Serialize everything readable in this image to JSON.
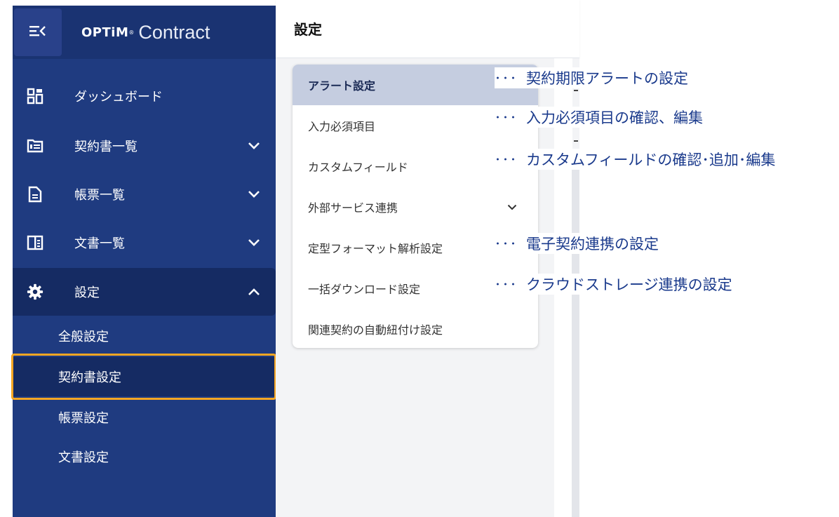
{
  "app": {
    "brand_optim": "OPTiM",
    "brand_tm": "®",
    "brand_product": "Contract"
  },
  "sidebar": {
    "items": [
      {
        "label": "ダッシュボード",
        "icon": "dashboard-icon",
        "chevron": ""
      },
      {
        "label": "契約書一覧",
        "icon": "folder-icon",
        "chevron": "down"
      },
      {
        "label": "帳票一覧",
        "icon": "document-icon",
        "chevron": "down"
      },
      {
        "label": "文書一覧",
        "icon": "book-icon",
        "chevron": "down"
      },
      {
        "label": "設定",
        "icon": "gear-icon",
        "chevron": "up"
      }
    ],
    "sub_items": [
      {
        "label": "全般設定"
      },
      {
        "label": "契約書設定"
      },
      {
        "label": "帳票設定"
      },
      {
        "label": "文書設定"
      }
    ],
    "selected_sub": "契約書設定"
  },
  "header": {
    "title": "設定"
  },
  "settings_menu": {
    "items": [
      {
        "label": "アラート設定"
      },
      {
        "label": "入力必須項目"
      },
      {
        "label": "カスタムフィールド"
      },
      {
        "label": "外部サービス連携"
      },
      {
        "label": "定型フォーマット解析設定"
      },
      {
        "label": "一括ダウンロード設定"
      },
      {
        "label": "関連契約の自動紐付け設定"
      }
    ],
    "active": "アラート設定"
  },
  "annotations": {
    "dots": "･･･",
    "items": [
      {
        "text": "契約期限アラートの設定"
      },
      {
        "text": "入力必須項目の確認、編集"
      },
      {
        "text": "カスタムフィールドの確認･追加･編集"
      },
      {
        "text": "電子契約連携の設定"
      },
      {
        "text": "クラウドストレージ連携の設定"
      }
    ]
  },
  "colors": {
    "sidebar_bg": "#1f3b80",
    "sidebar_active": "#152b63",
    "highlight_border": "#f5a623",
    "menu_active_bg": "#c5cde0",
    "annotation_text": "#1a3a8c"
  }
}
